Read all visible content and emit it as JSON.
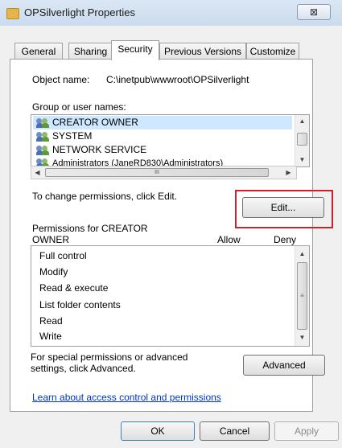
{
  "window": {
    "title": "OPSilverlight Properties",
    "close_glyph": "⊠"
  },
  "tabs": [
    {
      "label": "General",
      "active": false
    },
    {
      "label": "Sharing",
      "active": false
    },
    {
      "label": "Security",
      "active": true
    },
    {
      "label": "Previous Versions",
      "active": false
    },
    {
      "label": "Customize",
      "active": false
    }
  ],
  "security": {
    "object_name_label": "Object name:",
    "object_name_value": "C:\\inetpub\\wwwroot\\OPSilverlight",
    "group_label": "Group or user names:",
    "users": [
      {
        "name": "CREATOR OWNER",
        "icon": "users-icon",
        "selected": true
      },
      {
        "name": "SYSTEM",
        "icon": "users-icon",
        "selected": false
      },
      {
        "name": "NETWORK SERVICE",
        "icon": "users-icon",
        "selected": false
      },
      {
        "name": "Administrators (JaneRD830\\Administrators)",
        "icon": "users-icon",
        "selected": false
      }
    ],
    "hscroll_grip": "III",
    "change_text": "To change permissions, click Edit.",
    "edit_button": "Edit...",
    "permissions_for_label": "Permissions for CREATOR OWNER",
    "allow_header": "Allow",
    "deny_header": "Deny",
    "permissions": [
      "Full control",
      "Modify",
      "Read & execute",
      "List folder contents",
      "Read",
      "Write"
    ],
    "advanced_text": "For special permissions or advanced settings, click Advanced.",
    "advanced_button": "Advanced",
    "learn_link": "Learn about access control and permissions"
  },
  "footer": {
    "ok": "OK",
    "cancel": "Cancel",
    "apply": "Apply"
  },
  "colors": {
    "highlight": "#c8232c",
    "link": "#0033cc",
    "selection": "#cde8ff"
  }
}
